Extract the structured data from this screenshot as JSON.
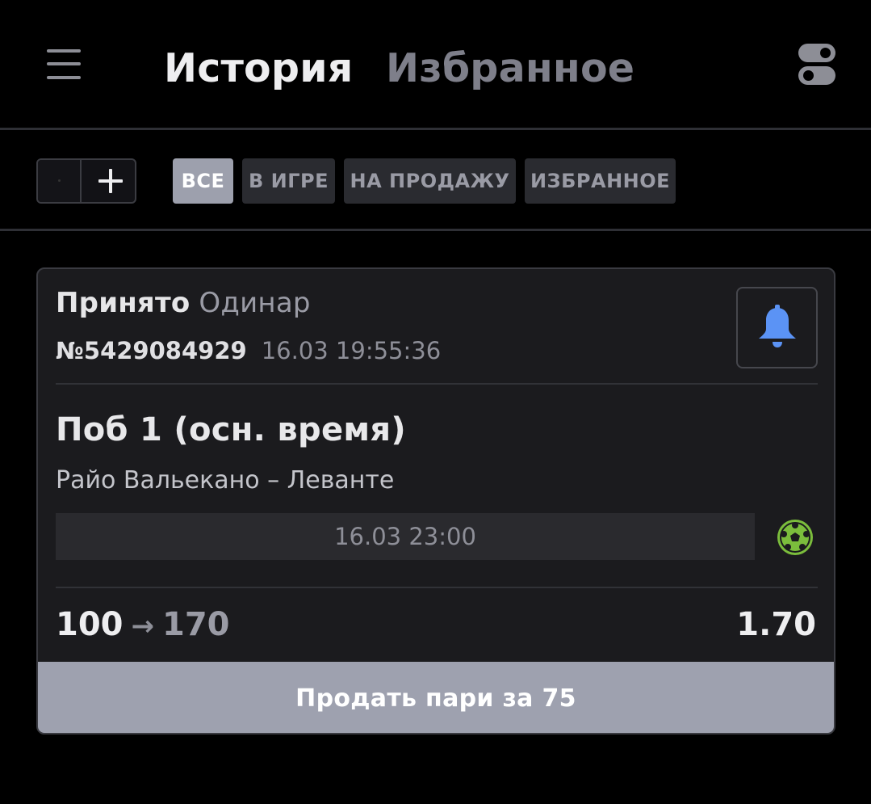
{
  "header": {
    "tabs": [
      {
        "label": "История",
        "active": true
      },
      {
        "label": "Избранное",
        "active": false
      }
    ],
    "menu_icon": "hamburger-menu-icon",
    "right_icon": "toggle-settings-icon"
  },
  "filters": {
    "stepper_plus": "+",
    "chips": [
      {
        "label": "ВСЕ",
        "active": true
      },
      {
        "label": "В ИГРЕ",
        "active": false
      },
      {
        "label": "НА ПРОДАЖУ",
        "active": false
      },
      {
        "label": "ИЗБРАННОЕ",
        "active": false
      }
    ]
  },
  "bet": {
    "status": "Принято",
    "type": "Одинар",
    "number": "№5429084929",
    "datetime": "16.03 19:55:36",
    "outcome": "Поб 1 (осн. время)",
    "match": "Райо Вальекано – Леванте",
    "match_time": "16.03 23:00",
    "sport_icon": "soccer-ball-icon",
    "stake": "100",
    "arrow": "→",
    "payout": "170",
    "odds": "1.70",
    "sell_label": "Продать пари за 75"
  },
  "colors": {
    "background": "#000000",
    "card": "#1b1b1e",
    "active_chip": "#9da0ad",
    "bell": "#5b93f5",
    "soccer": "#7bbd3c"
  }
}
